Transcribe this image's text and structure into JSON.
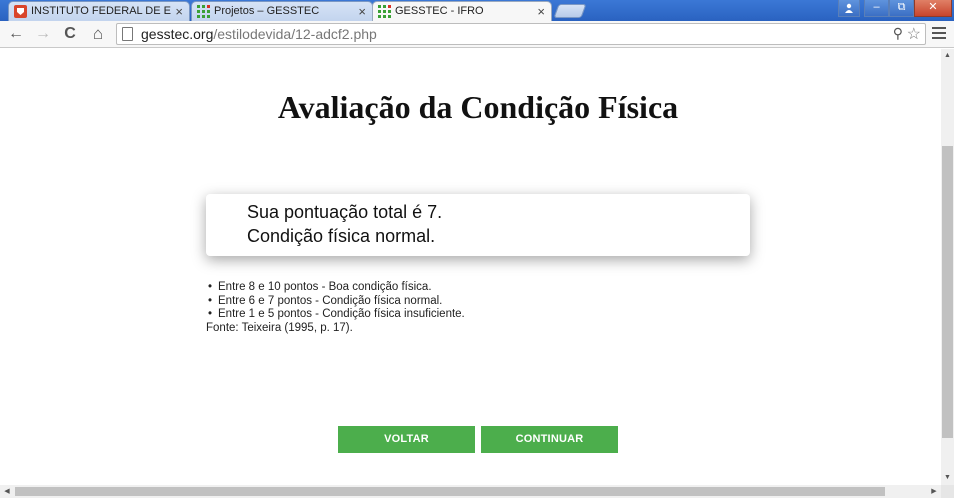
{
  "browser": {
    "tabs": [
      {
        "title": "INSTITUTO FEDERAL DE E",
        "active": false,
        "icon": "red-shield-favicon"
      },
      {
        "title": "Projetos – GESSTEC",
        "active": false,
        "icon": "gesstec-grid-favicon"
      },
      {
        "title": "GESSTEC - IFRO",
        "active": true,
        "icon": "gesstec-grid-favicon"
      }
    ],
    "tab_close_glyph": "×",
    "url": {
      "host": "gesstec.org",
      "path": "/estilodevida/12-adcf2.php"
    },
    "nav": {
      "back": "←",
      "forward": "→",
      "reload": "C",
      "home": "⌂"
    },
    "window_controls": {
      "minimize": "–",
      "restore": "⧉",
      "close": "✕"
    }
  },
  "page": {
    "title": "Avaliação da Condição Física",
    "result": {
      "line1": "Sua pontuação total é 7.",
      "line2": "Condição física normal."
    },
    "legend": [
      "Entre 8 e 10 pontos - Boa condição física.",
      "Entre 6 e 7 pontos - Condição física normal.",
      "Entre 1 e 5 pontos - Condição física insuficiente."
    ],
    "source": "Fonte: Teixeira (1995, p. 17).",
    "buttons": {
      "back": "VOLTAR",
      "continue": "CONTINUAR"
    }
  },
  "colors": {
    "button_green": "#4cae4c",
    "tabbar_blue": "#2f68c8"
  }
}
